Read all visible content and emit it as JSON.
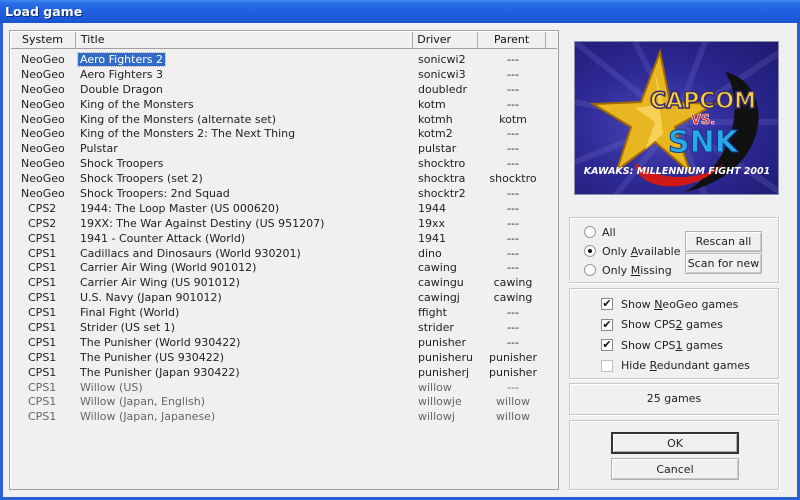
{
  "window": {
    "title": "Load game"
  },
  "list": {
    "columns": {
      "system": "System",
      "title": "Title",
      "driver": "Driver",
      "parent": "Parent"
    },
    "selected_index": 0,
    "rows": [
      {
        "system": "NeoGeo",
        "title": "Aero Fighters 2",
        "driver": "sonicwi2",
        "parent": "---"
      },
      {
        "system": "NeoGeo",
        "title": "Aero Fighters 3",
        "driver": "sonicwi3",
        "parent": "---"
      },
      {
        "system": "NeoGeo",
        "title": "Double Dragon",
        "driver": "doubledr",
        "parent": "---"
      },
      {
        "system": "NeoGeo",
        "title": "King of the Monsters",
        "driver": "kotm",
        "parent": "---"
      },
      {
        "system": "NeoGeo",
        "title": "King of the Monsters (alternate set)",
        "driver": "kotmh",
        "parent": "kotm"
      },
      {
        "system": "NeoGeo",
        "title": "King of the Monsters 2: The Next Thing",
        "driver": "kotm2",
        "parent": "---"
      },
      {
        "system": "NeoGeo",
        "title": "Pulstar",
        "driver": "pulstar",
        "parent": "---"
      },
      {
        "system": "NeoGeo",
        "title": "Shock Troopers",
        "driver": "shocktro",
        "parent": "---"
      },
      {
        "system": "NeoGeo",
        "title": "Shock Troopers (set 2)",
        "driver": "shocktra",
        "parent": "shocktro"
      },
      {
        "system": "NeoGeo",
        "title": "Shock Troopers: 2nd Squad",
        "driver": "shocktr2",
        "parent": "---"
      },
      {
        "system": "CPS2",
        "title": "1944: The Loop Master (US 000620)",
        "driver": "1944",
        "parent": "---"
      },
      {
        "system": "CPS2",
        "title": "19XX: The War Against Destiny (US 951207)",
        "driver": "19xx",
        "parent": "---"
      },
      {
        "system": "CPS1",
        "title": "1941 - Counter Attack (World)",
        "driver": "1941",
        "parent": "---"
      },
      {
        "system": "CPS1",
        "title": "Cadillacs and Dinosaurs (World 930201)",
        "driver": "dino",
        "parent": "---"
      },
      {
        "system": "CPS1",
        "title": "Carrier Air Wing (World 901012)",
        "driver": "cawing",
        "parent": "---"
      },
      {
        "system": "CPS1",
        "title": "Carrier Air Wing (US 901012)",
        "driver": "cawingu",
        "parent": "cawing"
      },
      {
        "system": "CPS1",
        "title": "U.S. Navy (Japan 901012)",
        "driver": "cawingj",
        "parent": "cawing"
      },
      {
        "system": "CPS1",
        "title": "Final Fight (World)",
        "driver": "ffight",
        "parent": "---"
      },
      {
        "system": "CPS1",
        "title": "Strider (US set 1)",
        "driver": "strider",
        "parent": "---"
      },
      {
        "system": "CPS1",
        "title": "The Punisher (World 930422)",
        "driver": "punisher",
        "parent": "---"
      },
      {
        "system": "CPS1",
        "title": "The Punisher (US 930422)",
        "driver": "punisheru",
        "parent": "punisher"
      },
      {
        "system": "CPS1",
        "title": "The Punisher (Japan 930422)",
        "driver": "punisherj",
        "parent": "punisher"
      },
      {
        "system": "CPS1",
        "title": "Willow (US)",
        "driver": "willow",
        "parent": "---",
        "dim": true
      },
      {
        "system": "CPS1",
        "title": "Willow (Japan, English)",
        "driver": "willowje",
        "parent": "willow",
        "dim": true
      },
      {
        "system": "CPS1",
        "title": "Willow (Japan, Japanese)",
        "driver": "willowj",
        "parent": "willow",
        "dim": true
      }
    ]
  },
  "preview": {
    "line1": "CAPCOM",
    "line2": "VS.",
    "line3": "SNK",
    "subtitle": "KAWAKS: MILLENNIUM FIGHT 2001"
  },
  "scan": {
    "options": [
      {
        "label_pre": "All",
        "accel": "",
        "label_post": "",
        "checked": false
      },
      {
        "label_pre": "Only ",
        "accel": "A",
        "label_post": "vailable",
        "checked": true
      },
      {
        "label_pre": "Only ",
        "accel": "M",
        "label_post": "issing",
        "checked": false
      }
    ],
    "rescan_label": "Rescan all",
    "scan_new_label": "Scan for new"
  },
  "filters": [
    {
      "pre": "Show ",
      "accel": "N",
      "post": "eoGeo games",
      "checked": true
    },
    {
      "pre": "Show CPS",
      "accel": "2",
      "post": " games",
      "checked": true
    },
    {
      "pre": "Show CPS",
      "accel": "1",
      "post": " games",
      "checked": true
    },
    {
      "pre": "Hide ",
      "accel": "R",
      "post": "edundant games",
      "checked": false
    }
  ],
  "status": {
    "count_text": "25 games"
  },
  "buttons": {
    "ok": "OK",
    "cancel": "Cancel"
  },
  "colors": {
    "titlebar": "#1e5ddc",
    "selection": "#316ac5",
    "background": "#f0f0f0"
  }
}
